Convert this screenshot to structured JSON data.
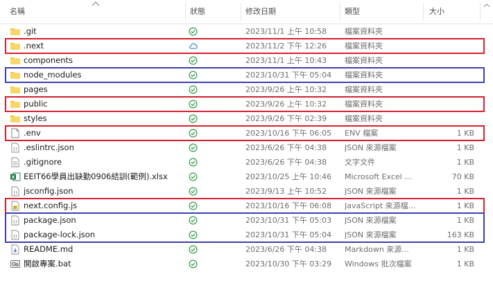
{
  "header": {
    "col_name": "名稱",
    "col_status": "狀態",
    "col_date": "修改日期",
    "col_type": "類型",
    "col_size": "大小"
  },
  "colors": {
    "red_highlight": "#d81e2c",
    "blue_highlight": "#3a3fb0",
    "folder_yellow": "#f5c33b",
    "status_green": "#2f9e44",
    "status_cloud_blue": "#1f78c9"
  },
  "rows": [
    {
      "name": ".git",
      "status": "synced",
      "date": "2023/11/1 上午 10:58",
      "type": "檔案資料夾",
      "size": "",
      "icon": "folder-icon"
    },
    {
      "name": ".next",
      "status": "cloud",
      "date": "2023/11/2 下午 12:26",
      "type": "檔案資料夾",
      "size": "",
      "icon": "folder-icon"
    },
    {
      "name": "components",
      "status": "synced",
      "date": "2023/11/1 上午 10:43",
      "type": "檔案資料夾",
      "size": "",
      "icon": "folder-icon"
    },
    {
      "name": "node_modules",
      "status": "synced",
      "date": "2023/10/31 下午 05:04",
      "type": "檔案資料夾",
      "size": "",
      "icon": "folder-icon"
    },
    {
      "name": "pages",
      "status": "synced",
      "date": "2023/9/26 上午 10:32",
      "type": "檔案資料夾",
      "size": "",
      "icon": "folder-icon"
    },
    {
      "name": "public",
      "status": "synced",
      "date": "2023/9/26 上午 10:32",
      "type": "檔案資料夾",
      "size": "",
      "icon": "folder-icon"
    },
    {
      "name": "styles",
      "status": "synced",
      "date": "2023/9/26 下午 02:39",
      "type": "檔案資料夾",
      "size": "",
      "icon": "folder-icon"
    },
    {
      "name": ".env",
      "status": "synced",
      "date": "2023/10/16 下午 06:05",
      "type": "ENV 檔案",
      "size": "1 KB",
      "icon": "blank-file-icon"
    },
    {
      "name": ".eslintrc.json",
      "status": "synced",
      "date": "2023/6/26 下午 04:38",
      "type": "JSON 來源檔案",
      "size": "1 KB",
      "icon": "json-file-icon"
    },
    {
      "name": ".gitignore",
      "status": "synced",
      "date": "2023/6/26 下午 04:38",
      "type": "文字文件",
      "size": "1 KB",
      "icon": "text-file-icon"
    },
    {
      "name": "EEIT66學員出缺勤0906結訓(範例).xlsx",
      "status": "synced",
      "date": "2023/10/25 上午 10:46",
      "type": "Microsoft Excel ...",
      "size": "70 KB",
      "icon": "excel-file-icon"
    },
    {
      "name": "jsconfig.json",
      "status": "synced",
      "date": "2023/9/13 上午 10:52",
      "type": "JSON 來源檔案",
      "size": "1 KB",
      "icon": "json-file-icon"
    },
    {
      "name": "next.config.js",
      "status": "synced",
      "date": "2023/10/16 下午 06:08",
      "type": "JavaScript 來源檔...",
      "size": "1 KB",
      "icon": "js-file-icon"
    },
    {
      "name": "package.json",
      "status": "synced",
      "date": "2023/10/31 下午 05:03",
      "type": "JSON 來源檔案",
      "size": "1 KB",
      "icon": "json-file-icon"
    },
    {
      "name": "package-lock.json",
      "status": "synced",
      "date": "2023/10/31 下午 05:04",
      "type": "JSON 來源檔案",
      "size": "163 KB",
      "icon": "json-file-icon"
    },
    {
      "name": "README.md",
      "status": "synced",
      "date": "2023/6/26 下午 04:38",
      "type": "Markdown 來源...",
      "size": "1 KB",
      "icon": "markdown-file-icon"
    },
    {
      "name": "開啟專案.bat",
      "status": "synced",
      "date": "2023/10/30 下午 03:29",
      "type": "Windows 批次檔案",
      "size": "1 KB",
      "icon": "bat-file-icon"
    }
  ],
  "highlights": [
    {
      "color": "red",
      "rows": [
        1
      ]
    },
    {
      "color": "blue",
      "rows": [
        3
      ]
    },
    {
      "color": "red",
      "rows": [
        5
      ]
    },
    {
      "color": "red",
      "rows": [
        7
      ]
    },
    {
      "color": "red",
      "rows": [
        12
      ]
    },
    {
      "color": "blue",
      "rows": [
        13,
        14
      ]
    }
  ]
}
